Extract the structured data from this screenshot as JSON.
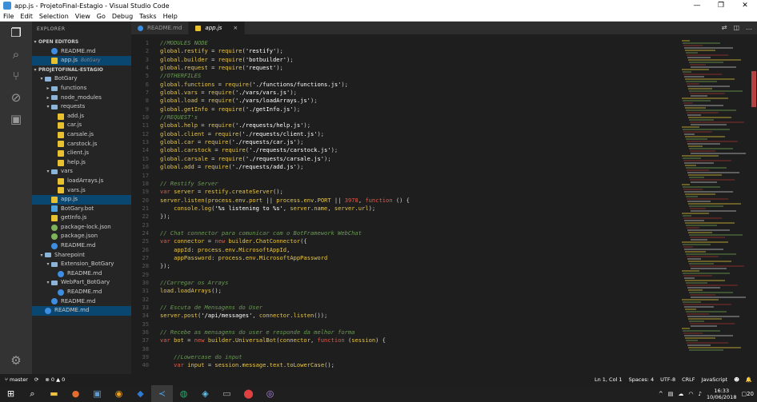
{
  "window": {
    "title": "app.js - ProjetoFinal-Estagio - Visual Studio Code"
  },
  "menu": [
    "File",
    "Edit",
    "Selection",
    "View",
    "Go",
    "Debug",
    "Tasks",
    "Help"
  ],
  "explorer": {
    "header": "EXPLORER",
    "open_editors_label": "OPEN EDITORS",
    "open_editors": [
      {
        "name": "README.md",
        "type": "md"
      },
      {
        "name": "app.js",
        "type": "js",
        "sub": "BotGary"
      }
    ],
    "project_label": "PROJETOFINAL-ESTAGIO",
    "tree": [
      {
        "name": "BotGary",
        "type": "folder",
        "depth": 1,
        "twisty": "▾"
      },
      {
        "name": "functions",
        "type": "folder",
        "depth": 2,
        "twisty": "▸"
      },
      {
        "name": "node_modules",
        "type": "folder",
        "depth": 2,
        "twisty": "▸"
      },
      {
        "name": "requests",
        "type": "folder",
        "depth": 2,
        "twisty": "▾"
      },
      {
        "name": "add.js",
        "type": "js",
        "depth": 3
      },
      {
        "name": "car.js",
        "type": "js",
        "depth": 3
      },
      {
        "name": "carsale.js",
        "type": "js",
        "depth": 3
      },
      {
        "name": "carstock.js",
        "type": "js",
        "depth": 3
      },
      {
        "name": "client.js",
        "type": "js",
        "depth": 3
      },
      {
        "name": "help.js",
        "type": "js",
        "depth": 3
      },
      {
        "name": "vars",
        "type": "folder",
        "depth": 2,
        "twisty": "▾"
      },
      {
        "name": "loadArrays.js",
        "type": "js",
        "depth": 3
      },
      {
        "name": "vars.js",
        "type": "js",
        "depth": 3
      },
      {
        "name": "app.js",
        "type": "js",
        "depth": 2,
        "selected": true
      },
      {
        "name": "BotGary.bot",
        "type": "bot",
        "depth": 2
      },
      {
        "name": "getInfo.js",
        "type": "js",
        "depth": 2
      },
      {
        "name": "package-lock.json",
        "type": "json",
        "depth": 2
      },
      {
        "name": "package.json",
        "type": "json",
        "depth": 2
      },
      {
        "name": "README.md",
        "type": "md",
        "depth": 2
      },
      {
        "name": "Sharepoint",
        "type": "folder",
        "depth": 1,
        "twisty": "▾"
      },
      {
        "name": "Extension_BotGary",
        "type": "folder",
        "depth": 2,
        "twisty": "▾"
      },
      {
        "name": "README.md",
        "type": "md",
        "depth": 3
      },
      {
        "name": "WebPart_BotGary",
        "type": "folder",
        "depth": 2,
        "twisty": "▾"
      },
      {
        "name": "README.md",
        "type": "md",
        "depth": 3
      },
      {
        "name": "README.md",
        "type": "md",
        "depth": 2
      },
      {
        "name": "README.md",
        "type": "md",
        "depth": 1,
        "selected": true
      }
    ]
  },
  "tabs": [
    {
      "label": "README.md",
      "type": "md",
      "active": false
    },
    {
      "label": "app.js",
      "type": "js",
      "active": true,
      "close": "×"
    }
  ],
  "code": [
    [
      [
        "c",
        "//MODULES NODE"
      ]
    ],
    [
      [
        "g",
        "global"
      ],
      [
        "p",
        "."
      ],
      [
        "v",
        "restify"
      ],
      [
        "p",
        " = "
      ],
      [
        "f",
        "require"
      ],
      [
        "p",
        "("
      ],
      [
        "s",
        "'restify'"
      ],
      [
        "p",
        ");"
      ]
    ],
    [
      [
        "g",
        "global"
      ],
      [
        "p",
        "."
      ],
      [
        "v",
        "builder"
      ],
      [
        "p",
        " = "
      ],
      [
        "f",
        "require"
      ],
      [
        "p",
        "("
      ],
      [
        "s",
        "'botbuilder'"
      ],
      [
        "p",
        ");"
      ]
    ],
    [
      [
        "g",
        "global"
      ],
      [
        "p",
        "."
      ],
      [
        "v",
        "request"
      ],
      [
        "p",
        " = "
      ],
      [
        "f",
        "require"
      ],
      [
        "p",
        "("
      ],
      [
        "s",
        "'request'"
      ],
      [
        "p",
        ");"
      ]
    ],
    [
      [
        "c",
        "//OTHERFILES"
      ]
    ],
    [
      [
        "g",
        "global"
      ],
      [
        "p",
        "."
      ],
      [
        "v",
        "functions"
      ],
      [
        "p",
        " = "
      ],
      [
        "f",
        "require"
      ],
      [
        "p",
        "("
      ],
      [
        "s",
        "'./functions/functions.js'"
      ],
      [
        "p",
        ");"
      ]
    ],
    [
      [
        "g",
        "global"
      ],
      [
        "p",
        "."
      ],
      [
        "v",
        "vars"
      ],
      [
        "p",
        " = "
      ],
      [
        "f",
        "require"
      ],
      [
        "p",
        "("
      ],
      [
        "s",
        "'./vars/vars.js'"
      ],
      [
        "p",
        ");"
      ]
    ],
    [
      [
        "g",
        "global"
      ],
      [
        "p",
        "."
      ],
      [
        "v",
        "load"
      ],
      [
        "p",
        " = "
      ],
      [
        "f",
        "require"
      ],
      [
        "p",
        "("
      ],
      [
        "s",
        "'./vars/loadArrays.js'"
      ],
      [
        "p",
        ");"
      ]
    ],
    [
      [
        "g",
        "global"
      ],
      [
        "p",
        "."
      ],
      [
        "v",
        "getInfo"
      ],
      [
        "p",
        " = "
      ],
      [
        "f",
        "require"
      ],
      [
        "p",
        "("
      ],
      [
        "s",
        "'./getInfo.js'"
      ],
      [
        "p",
        ");"
      ]
    ],
    [
      [
        "c",
        "//REQUEST's"
      ]
    ],
    [
      [
        "g",
        "global"
      ],
      [
        "p",
        "."
      ],
      [
        "v",
        "help"
      ],
      [
        "p",
        " = "
      ],
      [
        "f",
        "require"
      ],
      [
        "p",
        "("
      ],
      [
        "s",
        "'./requests/help.js'"
      ],
      [
        "p",
        ");"
      ]
    ],
    [
      [
        "g",
        "global"
      ],
      [
        "p",
        "."
      ],
      [
        "v",
        "client"
      ],
      [
        "p",
        " = "
      ],
      [
        "f",
        "require"
      ],
      [
        "p",
        "("
      ],
      [
        "s",
        "'./requests/client.js'"
      ],
      [
        "p",
        ");"
      ]
    ],
    [
      [
        "g",
        "global"
      ],
      [
        "p",
        "."
      ],
      [
        "v",
        "car"
      ],
      [
        "p",
        " = "
      ],
      [
        "f",
        "require"
      ],
      [
        "p",
        "("
      ],
      [
        "s",
        "'./requests/car.js'"
      ],
      [
        "p",
        ");"
      ]
    ],
    [
      [
        "g",
        "global"
      ],
      [
        "p",
        "."
      ],
      [
        "v",
        "carstock"
      ],
      [
        "p",
        " = "
      ],
      [
        "f",
        "require"
      ],
      [
        "p",
        "("
      ],
      [
        "s",
        "'./requests/carstock.js'"
      ],
      [
        "p",
        ");"
      ]
    ],
    [
      [
        "g",
        "global"
      ],
      [
        "p",
        "."
      ],
      [
        "v",
        "carsale"
      ],
      [
        "p",
        " = "
      ],
      [
        "f",
        "require"
      ],
      [
        "p",
        "("
      ],
      [
        "s",
        "'./requests/carsale.js'"
      ],
      [
        "p",
        ");"
      ]
    ],
    [
      [
        "g",
        "global"
      ],
      [
        "p",
        "."
      ],
      [
        "v",
        "add"
      ],
      [
        "p",
        " = "
      ],
      [
        "f",
        "require"
      ],
      [
        "p",
        "("
      ],
      [
        "s",
        "'./requests/add.js'"
      ],
      [
        "p",
        ");"
      ]
    ],
    [],
    [
      [
        "c",
        "// Restify Server"
      ]
    ],
    [
      [
        "k",
        "var"
      ],
      [
        "p",
        " "
      ],
      [
        "v",
        "server"
      ],
      [
        "p",
        " = "
      ],
      [
        "v",
        "restify"
      ],
      [
        "p",
        "."
      ],
      [
        "f",
        "createServer"
      ],
      [
        "p",
        "();"
      ]
    ],
    [
      [
        "v",
        "server"
      ],
      [
        "p",
        "."
      ],
      [
        "f",
        "listen"
      ],
      [
        "p",
        "("
      ],
      [
        "v",
        "process"
      ],
      [
        "p",
        "."
      ],
      [
        "v",
        "env"
      ],
      [
        "p",
        "."
      ],
      [
        "v",
        "port"
      ],
      [
        "p",
        " || "
      ],
      [
        "v",
        "process"
      ],
      [
        "p",
        "."
      ],
      [
        "v",
        "env"
      ],
      [
        "p",
        "."
      ],
      [
        "v",
        "PORT"
      ],
      [
        "p",
        " || "
      ],
      [
        "n",
        "3978"
      ],
      [
        "p",
        ", "
      ],
      [
        "k",
        "function"
      ],
      [
        "p",
        " () {"
      ]
    ],
    [
      [
        "p",
        "    "
      ],
      [
        "v",
        "console"
      ],
      [
        "p",
        "."
      ],
      [
        "f",
        "log"
      ],
      [
        "p",
        "("
      ],
      [
        "s",
        "'%s listening to %s'"
      ],
      [
        "p",
        ", "
      ],
      [
        "v",
        "server"
      ],
      [
        "p",
        "."
      ],
      [
        "v",
        "name"
      ],
      [
        "p",
        ", "
      ],
      [
        "v",
        "server"
      ],
      [
        "p",
        "."
      ],
      [
        "v",
        "url"
      ],
      [
        "p",
        ");"
      ]
    ],
    [
      [
        "p",
        "});"
      ]
    ],
    [],
    [
      [
        "c",
        "// Chat connector para comunicar com o BotFramework WebChat"
      ]
    ],
    [
      [
        "k",
        "var"
      ],
      [
        "p",
        " "
      ],
      [
        "v",
        "connector"
      ],
      [
        "p",
        " = "
      ],
      [
        "k",
        "new"
      ],
      [
        "p",
        " "
      ],
      [
        "v",
        "builder"
      ],
      [
        "p",
        "."
      ],
      [
        "f",
        "ChatConnector"
      ],
      [
        "p",
        "({"
      ]
    ],
    [
      [
        "p",
        "    "
      ],
      [
        "v",
        "appId"
      ],
      [
        "p",
        ": "
      ],
      [
        "v",
        "process"
      ],
      [
        "p",
        "."
      ],
      [
        "v",
        "env"
      ],
      [
        "p",
        "."
      ],
      [
        "v",
        "MicrosoftAppId"
      ],
      [
        "p",
        ","
      ]
    ],
    [
      [
        "p",
        "    "
      ],
      [
        "v",
        "appPassword"
      ],
      [
        "p",
        ": "
      ],
      [
        "v",
        "process"
      ],
      [
        "p",
        "."
      ],
      [
        "v",
        "env"
      ],
      [
        "p",
        "."
      ],
      [
        "v",
        "MicrosoftAppPassword"
      ]
    ],
    [
      [
        "p",
        "});"
      ]
    ],
    [],
    [
      [
        "c",
        "//Carregar os Arrays"
      ]
    ],
    [
      [
        "v",
        "load"
      ],
      [
        "p",
        "."
      ],
      [
        "f",
        "loadArrays"
      ],
      [
        "p",
        "();"
      ]
    ],
    [],
    [
      [
        "c",
        "// Escuta de Mensagens do User"
      ]
    ],
    [
      [
        "v",
        "server"
      ],
      [
        "p",
        "."
      ],
      [
        "f",
        "post"
      ],
      [
        "p",
        "("
      ],
      [
        "s",
        "'/api/messages'"
      ],
      [
        "p",
        ", "
      ],
      [
        "v",
        "connector"
      ],
      [
        "p",
        "."
      ],
      [
        "f",
        "listen"
      ],
      [
        "p",
        "());"
      ]
    ],
    [],
    [
      [
        "c",
        "// Recebe as mensagens do user e responde da melhor forma"
      ]
    ],
    [
      [
        "k",
        "var"
      ],
      [
        "p",
        " "
      ],
      [
        "v",
        "bot"
      ],
      [
        "p",
        " = "
      ],
      [
        "k",
        "new"
      ],
      [
        "p",
        " "
      ],
      [
        "v",
        "builder"
      ],
      [
        "p",
        "."
      ],
      [
        "f",
        "UniversalBot"
      ],
      [
        "p",
        "("
      ],
      [
        "v",
        "connector"
      ],
      [
        "p",
        ", "
      ],
      [
        "k",
        "function"
      ],
      [
        "p",
        " ("
      ],
      [
        "v",
        "session"
      ],
      [
        "p",
        ") {"
      ]
    ],
    [],
    [
      [
        "p",
        "    "
      ],
      [
        "c",
        "//Lowercase do input"
      ]
    ],
    [
      [
        "p",
        "    "
      ],
      [
        "k",
        "var"
      ],
      [
        "p",
        " "
      ],
      [
        "v",
        "input"
      ],
      [
        "p",
        " = "
      ],
      [
        "v",
        "session"
      ],
      [
        "p",
        "."
      ],
      [
        "v",
        "message"
      ],
      [
        "p",
        "."
      ],
      [
        "v",
        "text"
      ],
      [
        "p",
        "."
      ],
      [
        "f",
        "toLowerCase"
      ],
      [
        "p",
        "();"
      ]
    ]
  ],
  "colors": {
    "c": "#6a9955",
    "g": "#e8c547",
    "v": "#e8c547",
    "p": "#d4d4d4",
    "f": "#e8c547",
    "s": "#ffffff",
    "k": "#e05b4b",
    "n": "#e05b4b"
  },
  "status": {
    "branch": "master",
    "sync": "⟳",
    "errors": "⊗ 0",
    "warnings": "▲ 0",
    "position": "Ln 1, Col 1",
    "spaces": "Spaces: 4",
    "encoding": "UTF-8",
    "eol": "CRLF",
    "language": "JavaScript",
    "smiley": "☻",
    "bell": "🔔"
  },
  "taskbar": {
    "time": "16:33",
    "date": "10/06/2018",
    "notif": "20"
  }
}
